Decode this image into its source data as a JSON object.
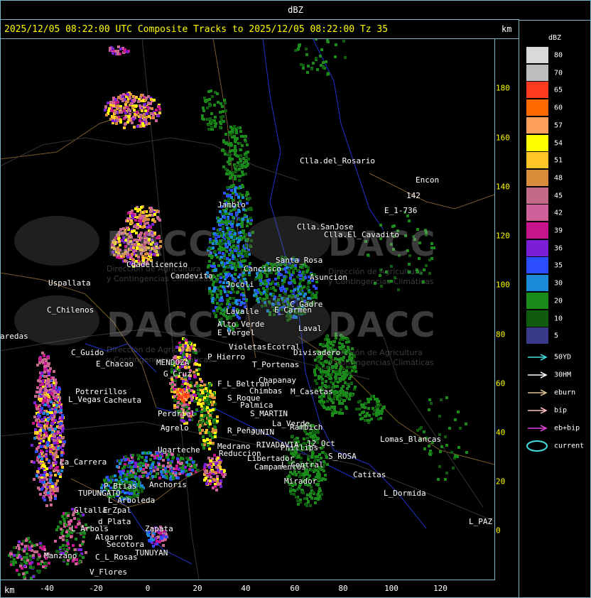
{
  "top_title": "dBZ",
  "map_title": "2025/12/05 08:22:00 UTC Composite Tracks to 2025/12/05 08:22:00 Tz 35",
  "km_top": "km",
  "km_bottom": "km",
  "x_axis_ticks": [
    "-40",
    "-20",
    "0",
    "20",
    "40",
    "60",
    "80",
    "100",
    "120"
  ],
  "y_axis_ticks": [
    "180",
    "160",
    "140",
    "120",
    "100",
    "80",
    "60",
    "40",
    "20",
    "0"
  ],
  "watermark": {
    "brand": "DACC",
    "sub_line1": "Dirección de Agricultura",
    "sub_line2": "y Contingencias Climáticas"
  },
  "legend": {
    "title": "dBZ",
    "levels": [
      {
        "label": "80",
        "color": "#d9d9d9"
      },
      {
        "label": "70",
        "color": "#bdbdbd"
      },
      {
        "label": "65",
        "color": "#ff3a1f"
      },
      {
        "label": "60",
        "color": "#ff6a00"
      },
      {
        "label": "57",
        "color": "#ff9f5c"
      },
      {
        "label": "54",
        "color": "#ffff00"
      },
      {
        "label": "51",
        "color": "#ffc427"
      },
      {
        "label": "48",
        "color": "#d98c3a"
      },
      {
        "label": "45",
        "color": "#c26a8a"
      },
      {
        "label": "42",
        "color": "#d0609a"
      },
      {
        "label": "39",
        "color": "#c8148c"
      },
      {
        "label": "36",
        "color": "#7a1fd6"
      },
      {
        "label": "35",
        "color": "#2a4dff"
      },
      {
        "label": "30",
        "color": "#1a8ad9"
      },
      {
        "label": "20",
        "color": "#1a8a1a"
      },
      {
        "label": "10",
        "color": "#0f5c0f"
      },
      {
        "label": "5",
        "color": "#3a3a8a"
      }
    ]
  },
  "tracks": [
    {
      "label": "50YD",
      "color": "#40e0e0"
    },
    {
      "label": "30HM",
      "color": "#ffffff"
    },
    {
      "label": "eburn",
      "color": "#e0c090"
    },
    {
      "label": "bip",
      "color": "#ffc0c0"
    },
    {
      "label": "eb+bip",
      "color": "#e040e0"
    },
    {
      "label": "current",
      "color": "#40e0e0"
    }
  ],
  "places": [
    {
      "name": "Clla.del_Rosario"
    },
    {
      "name": "Encon"
    },
    {
      "name": "142"
    },
    {
      "name": "E_1-736"
    },
    {
      "name": "Clla.SanJose"
    },
    {
      "name": "Clla.El_Cavadito"
    },
    {
      "name": "Uspallata"
    },
    {
      "name": "C_Chilenos"
    },
    {
      "name": "aredas"
    },
    {
      "name": "C_Guido"
    },
    {
      "name": "E_Chacao"
    },
    {
      "name": "Potrerillos"
    },
    {
      "name": "Cacheuta"
    },
    {
      "name": "L_Vegas"
    },
    {
      "name": "La_Carrera"
    },
    {
      "name": "P_Btias"
    },
    {
      "name": "TUPUNGATO"
    },
    {
      "name": "Anchoris"
    },
    {
      "name": "L_Arboleda"
    },
    {
      "name": "Gltallar"
    },
    {
      "name": "E_Zpal"
    },
    {
      "name": "d_Plata"
    },
    {
      "name": "L_Arbols"
    },
    {
      "name": "Algarrob"
    },
    {
      "name": "Secotora"
    },
    {
      "name": "C_L_Rosas"
    },
    {
      "name": "TUNUYAN"
    },
    {
      "name": "V_Flores"
    },
    {
      "name": "Manzano"
    },
    {
      "name": "Zapata"
    },
    {
      "name": "Candevita"
    },
    {
      "name": "Jocoli"
    },
    {
      "name": "Lavalle"
    },
    {
      "name": "Alto_Verde"
    },
    {
      "name": "E_Vergel"
    },
    {
      "name": "P_Hierro"
    },
    {
      "name": "Violetas"
    },
    {
      "name": "Ecotral"
    },
    {
      "name": "Divisadero"
    },
    {
      "name": "T_Portenas"
    },
    {
      "name": "Chapanay"
    },
    {
      "name": "M_Casetas"
    },
    {
      "name": "F_L_Beltran"
    },
    {
      "name": "Chimbas"
    },
    {
      "name": "S_Roque"
    },
    {
      "name": "Palmica"
    },
    {
      "name": "S_MARTIN"
    },
    {
      "name": "JUNIN"
    },
    {
      "name": "R_Peña"
    },
    {
      "name": "La_Verde"
    },
    {
      "name": "Rambich"
    },
    {
      "name": "12_Oct"
    },
    {
      "name": "Phillips"
    },
    {
      "name": "RIVADAVIA"
    },
    {
      "name": "Medrano"
    },
    {
      "name": "Reduccion"
    },
    {
      "name": "Libertador"
    },
    {
      "name": "Campamentos"
    },
    {
      "name": "L_Central"
    },
    {
      "name": "S_ROSA"
    },
    {
      "name": "Lomas_Blancas"
    },
    {
      "name": "Catitas"
    },
    {
      "name": "Mirador"
    },
    {
      "name": "L_Dormida"
    },
    {
      "name": "L_PAZ"
    },
    {
      "name": "Agrelo"
    },
    {
      "name": "Perdriel"
    },
    {
      "name": "Ugarteche"
    },
    {
      "name": "MENDOZA"
    },
    {
      "name": "G_Cruz"
    },
    {
      "name": "Santa_Rosa"
    },
    {
      "name": "Asuncion"
    },
    {
      "name": "E_Carmen"
    },
    {
      "name": "C_Gadre"
    },
    {
      "name": "Laval"
    },
    {
      "name": "Cancisco"
    },
    {
      "name": "Jamblo"
    },
    {
      "name": "Cdadelicencio"
    }
  ]
}
